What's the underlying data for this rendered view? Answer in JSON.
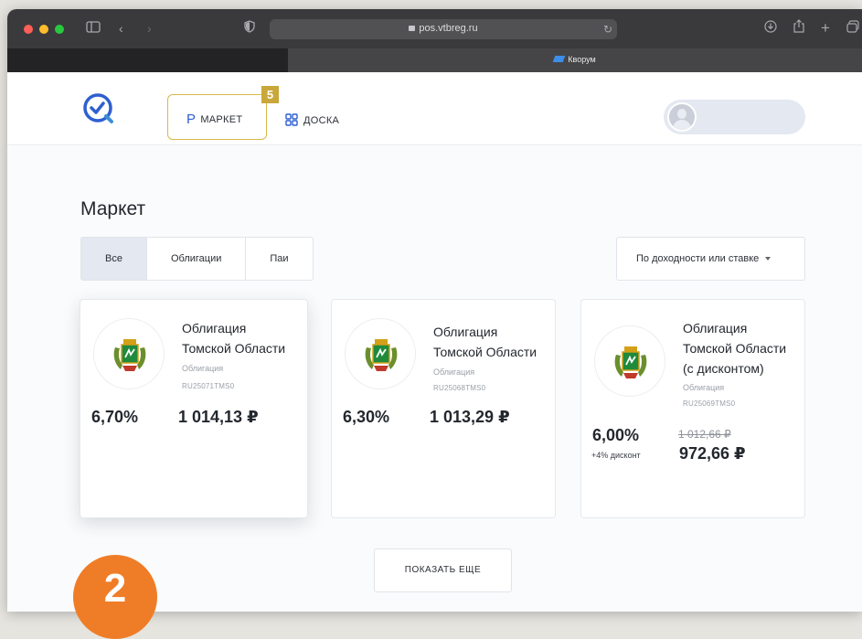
{
  "browser": {
    "url": "pos.vtbreg.ru",
    "tab_title": "Кворум"
  },
  "nav": {
    "market_label": "МАРКЕТ",
    "market_badge": "5",
    "board_label": "ДОСКА"
  },
  "page": {
    "title": "Маркет",
    "filters": [
      "Все",
      "Облигации",
      "Паи"
    ],
    "active_filter": "Все",
    "sort_label": "По доходности или ставке"
  },
  "cards": [
    {
      "title_line1": "Облигация",
      "title_line2": "Томской Области",
      "kind": "Облигация",
      "isin": "RU25071TMS0",
      "rate": "6,70%",
      "price": "1 014,13 ₽"
    },
    {
      "title_line1": "Облигация",
      "title_line2": "Томской Области",
      "kind": "Облигация",
      "isin": "RU25068TMS0",
      "rate": "6,30%",
      "price": "1 013,29 ₽"
    },
    {
      "title_line1": "Облигация",
      "title_line2": "Томской Области",
      "title_line3": "(с дисконтом)",
      "kind": "Облигация",
      "isin": "RU25069TMS0",
      "rate": "6,00%",
      "discount": "+4% дисконт",
      "old_price": "1 012,66 ₽",
      "price": "972,66 ₽"
    }
  ],
  "show_more_label": "ПОКАЗАТЬ ЕЩЕ",
  "step_badge": "2",
  "colors": {
    "accent_gold": "#c9a73a",
    "accent_blue": "#2f5fd0",
    "step_orange": "#ef7d27"
  }
}
